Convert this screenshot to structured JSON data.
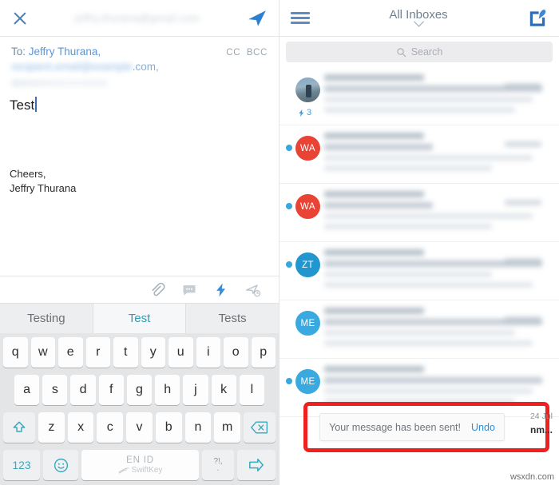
{
  "compose": {
    "close_icon": "close-x-icon",
    "title_redacted": "jeffry.thurana@gmail.com",
    "send_icon": "paper-plane-send-icon",
    "to_label": "To:",
    "to_recipient": "Jeffry Thurana,",
    "to_recipient_2_redacted": "recipient.email@example",
    "to_recipient_2_suffix": ".com,",
    "cc_label": "CC",
    "bcc_label": "BCC",
    "body_text": "Test",
    "signature_line1": "Cheers,",
    "signature_line2": "Jeffry Thurana",
    "toolbar_icons": [
      {
        "name": "paperclip-attach-icon",
        "label": "Attach"
      },
      {
        "name": "chat-bubble-icon",
        "label": "Comment"
      },
      {
        "name": "lightning-bolt-icon",
        "label": "Quick reply"
      },
      {
        "name": "send-later-clock-icon",
        "label": "Send later"
      }
    ]
  },
  "predictions": {
    "items": [
      {
        "label": "Testing",
        "active": false
      },
      {
        "label": "Test",
        "active": true
      },
      {
        "label": "Tests",
        "active": false
      }
    ]
  },
  "keyboard": {
    "row1": [
      "q",
      "w",
      "e",
      "r",
      "t",
      "y",
      "u",
      "i",
      "o",
      "p"
    ],
    "row2": [
      "a",
      "s",
      "d",
      "f",
      "g",
      "h",
      "j",
      "k",
      "l"
    ],
    "row3": [
      "z",
      "x",
      "c",
      "v",
      "b",
      "n",
      "m"
    ],
    "shift_icon": "shift-up-arrow-icon",
    "backspace_icon": "backspace-delete-icon",
    "num_label": "123",
    "emoji_icon": "smiley-emoji-icon",
    "space_lang": "EN ID",
    "space_brand": "SwiftKey",
    "punct_top": "?!,",
    "punct_bottom": ".",
    "enter_icon": "enter-arrow-icon"
  },
  "inbox": {
    "menu_icon": "hamburger-menu-icon",
    "title": "All Inboxes",
    "chevron_icon": "chevron-down-icon",
    "compose_icon": "compose-pencil-icon",
    "search_icon": "search-icon",
    "search_placeholder": "Search",
    "rows": [
      {
        "avatar_type": "photo",
        "initials": "",
        "avatar_color": "#6e8594",
        "unread": false,
        "bolt_count": "3"
      },
      {
        "avatar_type": "initials",
        "initials": "WA",
        "avatar_color": "#e94335",
        "unread": true,
        "bolt_count": ""
      },
      {
        "avatar_type": "initials",
        "initials": "WA",
        "avatar_color": "#e94335",
        "unread": true,
        "bolt_count": ""
      },
      {
        "avatar_type": "initials",
        "initials": "ZT",
        "avatar_color": "#2196cf",
        "unread": true,
        "bolt_count": ""
      },
      {
        "avatar_type": "initials",
        "initials": "ME",
        "avatar_color": "#3aa9e0",
        "unread": false,
        "bolt_count": ""
      },
      {
        "avatar_type": "initials",
        "initials": "ME",
        "avatar_color": "#3aa9e0",
        "unread": true,
        "bolt_count": ""
      }
    ]
  },
  "toast": {
    "message": "Your message has been sent!",
    "undo_label": "Undo",
    "highlight_color": "#ee2020"
  },
  "overlay": {
    "row_date": "24 Jul",
    "row_snippet": "nm...",
    "watermark": "wsxdn.com"
  }
}
